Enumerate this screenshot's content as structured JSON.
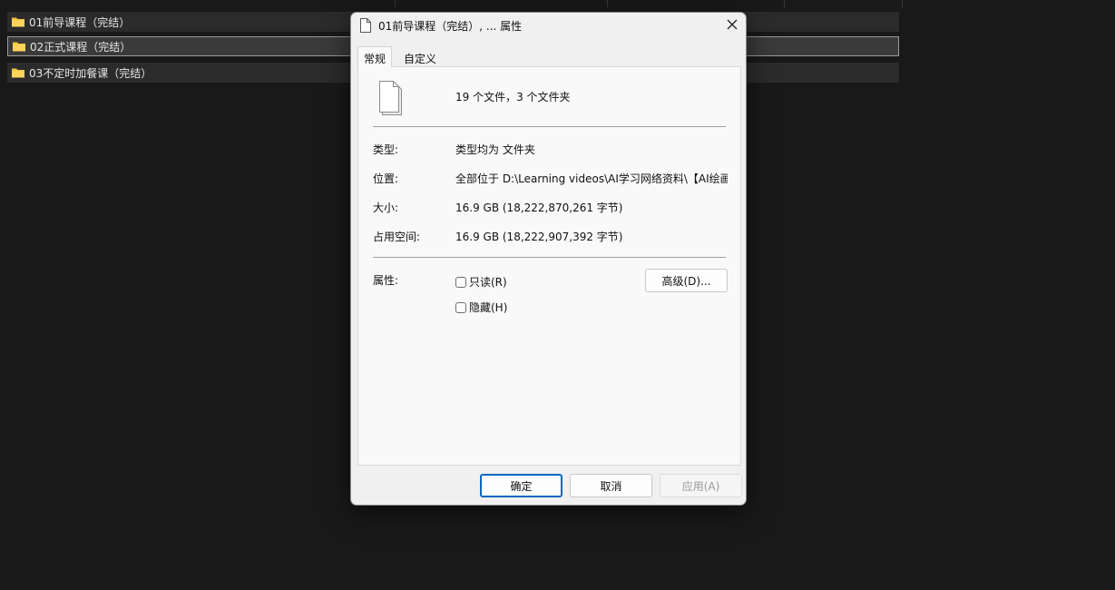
{
  "explorer": {
    "rows": [
      {
        "name": "01前导课程（完结）"
      },
      {
        "name": "02正式课程（完结）"
      },
      {
        "name": "03不定时加餐课（完结）"
      }
    ]
  },
  "dialog": {
    "title": "01前导课程（完结）, ... 属性",
    "tabs": [
      {
        "label": "常规"
      },
      {
        "label": "自定义"
      }
    ],
    "summary": "19 个文件，3 个文件夹",
    "type_label": "类型:",
    "type_value": "类型均为 文件夹",
    "location_label": "位置:",
    "location_value": "全部位于 D:\\Learning videos\\AI学习网络资料\\【AI绘画",
    "size_label": "大小:",
    "size_value": "16.9 GB (18,222,870,261 字节)",
    "disk_label": "占用空间:",
    "disk_value": "16.9 GB (18,222,907,392 字节)",
    "attributes_label": "属性:",
    "readonly_label": "只读(R)",
    "hidden_label": "隐藏(H)",
    "advanced_button": "高级(D)...",
    "ok_button": "确定",
    "cancel_button": "取消",
    "apply_button": "应用(A)"
  },
  "colors": {
    "background": "#191919",
    "folder": "#f4c542",
    "accent": "#0067c0"
  }
}
